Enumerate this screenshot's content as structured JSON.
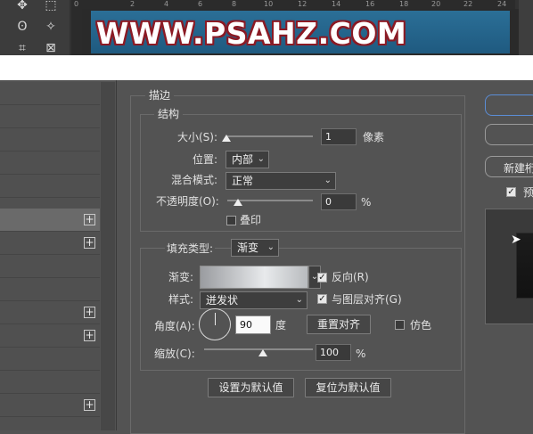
{
  "toolbar": {
    "tools": [
      "move-tool",
      "marquee-tool",
      "lasso-tool",
      "magic-wand-tool",
      "crop-tool",
      "frame-tool"
    ],
    "ruler_ticks": [
      "0",
      "2",
      "4",
      "6",
      "8",
      "10",
      "12",
      "14",
      "16",
      "18",
      "20",
      "22",
      "24"
    ]
  },
  "banner": {
    "text": "WWW.PSAHZ.COM"
  },
  "dialog": {
    "section_title": "描边",
    "structure": {
      "title": "结构",
      "size_label": "大小(S):",
      "size_value": "1",
      "size_unit": "像素",
      "position_label": "位置:",
      "position_value": "内部",
      "blend_label": "混合模式:",
      "blend_value": "正常",
      "opacity_label": "不透明度(O):",
      "opacity_value": "0",
      "opacity_unit": "%",
      "overprint_label": "叠印",
      "overprint_checked": false
    },
    "fill": {
      "title_label": "填充类型:",
      "fill_type_value": "渐变",
      "gradient_label": "渐变:",
      "reverse_label": "反向(R)",
      "reverse_checked": true,
      "style_label": "样式:",
      "style_value": "迸发状",
      "align_label": "与图层对齐(G)",
      "align_checked": true,
      "angle_label": "角度(A):",
      "angle_value": "90",
      "angle_unit": "度",
      "reset_align_button": "重置对齐",
      "dither_label": "仿色",
      "dither_checked": false,
      "scale_label": "缩放(C):",
      "scale_value": "100",
      "scale_unit": "%"
    },
    "default_button": "设置为默认值",
    "reset_default_button": "复位为默认值"
  },
  "right_panel": {
    "new_style_button_partial": "新建桁",
    "preview_label_partial": "预"
  }
}
